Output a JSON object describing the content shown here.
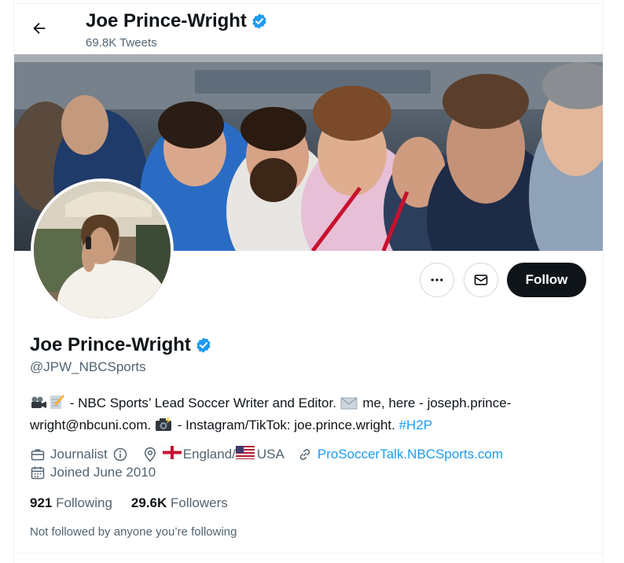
{
  "header": {
    "name": "Joe Prince-Wright",
    "tweets_count": "69.8K Tweets"
  },
  "profile": {
    "display_name": "Joe Prince-Wright",
    "handle": "@JPW_NBCSports",
    "bio": {
      "part1": " - NBC Sports’ Lead Soccer Writer and Editor. ",
      "part2": " me, here - joseph.prince-wright@nbcuni.com. ",
      "part3": " - Instagram/TikTok: joe.prince.wright. ",
      "hashtag": "#H2P"
    },
    "occupation": "Journalist",
    "location_country1": "England/",
    "location_country2": "USA",
    "website": "ProSoccerTalk.NBCSports.com",
    "joined": "Joined June 2010",
    "following_count": "921",
    "following_label": "Following",
    "followers_count": "29.6K",
    "followers_label": "Followers",
    "not_followed_text": "Not followed by anyone you’re following"
  },
  "actions": {
    "follow_label": "Follow"
  },
  "colors": {
    "accent": "#1d9bf0",
    "text": "#0f1419",
    "secondary": "#536471",
    "follow_bg": "#0f1419"
  },
  "icons": [
    "back-arrow-icon",
    "verified-badge-icon",
    "more-icon",
    "message-icon",
    "briefcase-icon",
    "info-icon",
    "location-pin-icon",
    "link-icon",
    "calendar-icon"
  ]
}
